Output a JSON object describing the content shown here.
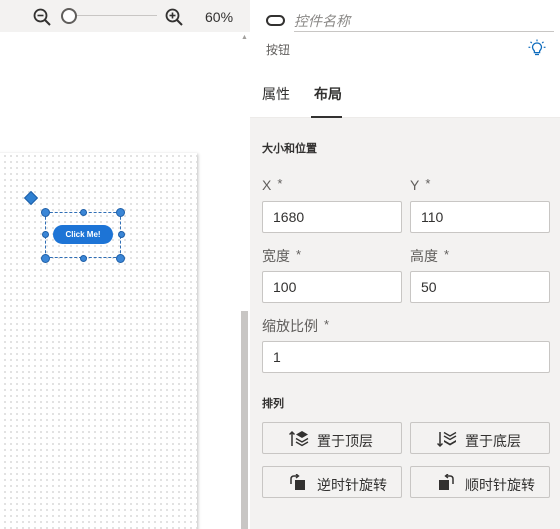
{
  "canvas": {
    "zoom_value": "60%",
    "button_text": "Click Me!"
  },
  "header": {
    "control_name_placeholder": "控件名称",
    "control_type": "按钮",
    "icons": [
      "button-control-icon",
      "lightbulb-icon"
    ]
  },
  "tabs": [
    {
      "label": "属性",
      "active": false
    },
    {
      "label": "布局",
      "active": true
    }
  ],
  "size_position": {
    "title": "大小和位置",
    "x": {
      "label": "X",
      "required": "*",
      "value": "1680"
    },
    "y": {
      "label": "Y",
      "required": "*",
      "value": "110"
    },
    "width": {
      "label": "宽度",
      "required": "*",
      "value": "100"
    },
    "height": {
      "label": "高度",
      "required": "*",
      "value": "50"
    },
    "scale": {
      "label": "缩放比例",
      "required": "*",
      "value": "1"
    }
  },
  "arrange": {
    "title": "排列",
    "bring_to_front": "置于顶层",
    "send_to_back": "置于底层",
    "rotate_ccw": "逆时针旋转",
    "rotate_cw": "顺时针旋转"
  },
  "colors": {
    "accent": "#1d74d6",
    "selection": "#2f6eb5",
    "panel_bg": "#f3f2f1"
  }
}
